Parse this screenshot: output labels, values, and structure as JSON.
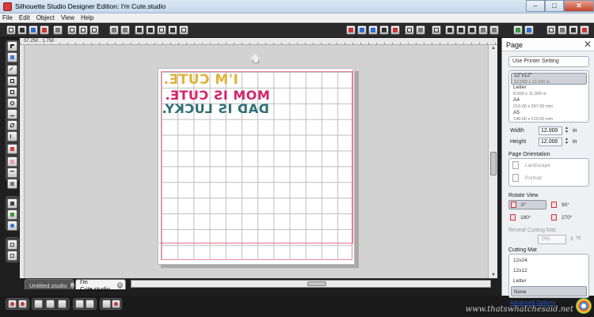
{
  "window": {
    "title": "Silhouette Studio Designer Edition: I'm Cute.studio",
    "minimize": "–",
    "maximize": "□",
    "close": "✕"
  },
  "menu": [
    "File",
    "Edit",
    "Object",
    "View",
    "Help"
  ],
  "workspace": {
    "coords": "37.250 , 1.750",
    "design_lines": [
      "I'M CUTE.",
      "MOM IS CUTE.",
      "DAD IS LUCKY."
    ],
    "design_colors": [
      "#e0b13c",
      "#d3256b",
      "#2f6f74"
    ],
    "scroll_up": "▲",
    "scroll_down": "▼"
  },
  "tabs": [
    {
      "label": "Untitled.studio",
      "active": false
    },
    {
      "label": "I'm Cute.studio",
      "active": true
    }
  ],
  "tab_close_glyph": "✕",
  "panel": {
    "title": "Page",
    "close": "✕",
    "printer_button": "Use Printer Setting",
    "page_sizes": [
      {
        "name": "12\"x12\"",
        "dim": "12.000 x 12.000 in",
        "selected": true
      },
      {
        "name": "Letter",
        "dim": "8.500 x 11.000 in",
        "selected": false
      },
      {
        "name": "A4",
        "dim": "210.00 x 297.00 mm",
        "selected": false
      },
      {
        "name": "A5",
        "dim": "148.00 x 210.00 mm",
        "selected": false
      }
    ],
    "width_label": "Width",
    "width_value": "12.000",
    "height_label": "Height",
    "height_value": "12.000",
    "unit": "in",
    "orientation_label": "Page Orientation",
    "orientations": [
      "Landscape",
      "Portrait"
    ],
    "rotate_label": "Rotate View",
    "rotations": [
      "0°",
      "90°",
      "180°",
      "270°"
    ],
    "reveal_label": "Reveal Cutting Mat",
    "reveal_value": "0%",
    "reveal_unit": "%",
    "mat_label": "Cutting Mat",
    "mats": [
      {
        "name": "12x24",
        "selected": false
      },
      {
        "name": "12x12",
        "selected": false
      },
      {
        "name": "Letter",
        "selected": false
      },
      {
        "name": "None",
        "selected": true
      }
    ],
    "advanced_link": "Advanced Options"
  },
  "watermark": "www.thatswhatchesaid.net"
}
